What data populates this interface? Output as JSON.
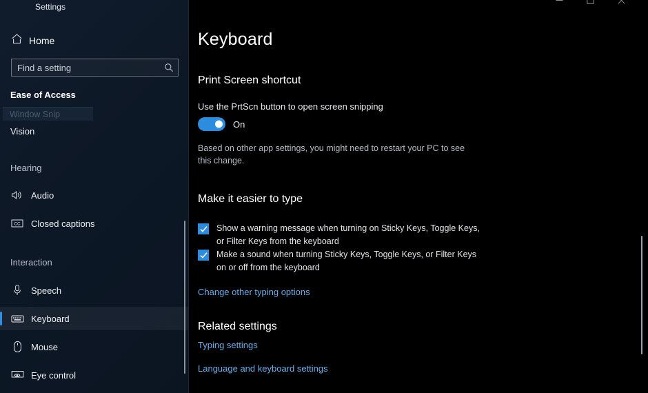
{
  "window": {
    "title": "Settings",
    "controls": {
      "minimize": "minimize-icon",
      "maximize": "maximize-icon",
      "close": "close-icon"
    }
  },
  "sidebar": {
    "home_label": "Home",
    "home_icon": "home-icon",
    "search": {
      "placeholder": "Find a setting",
      "value": "",
      "icon": "search-icon"
    },
    "category_title": "Ease of Access",
    "ghost_overlay": "Window Snip",
    "items": [
      {
        "label": "Vision",
        "icon": "none",
        "selected": false
      },
      {
        "label": "Hearing",
        "icon": "none",
        "selected": false,
        "is_group": true
      },
      {
        "label": "Audio",
        "icon": "speaker-icon",
        "selected": false
      },
      {
        "label": "Closed captions",
        "icon": "closed-captions-icon",
        "selected": false
      },
      {
        "label": "Interaction",
        "icon": "none",
        "selected": false,
        "is_group": true
      },
      {
        "label": "Speech",
        "icon": "microphone-icon",
        "selected": false
      },
      {
        "label": "Keyboard",
        "icon": "keyboard-icon",
        "selected": true
      },
      {
        "label": "Mouse",
        "icon": "mouse-icon",
        "selected": false
      },
      {
        "label": "Eye control",
        "icon": "eye-control-icon",
        "selected": false
      }
    ]
  },
  "main": {
    "page_title": "Keyboard",
    "print_screen": {
      "heading": "Print Screen shortcut",
      "description": "Use the PrtScn button to open screen snipping",
      "toggle_state": "On",
      "toggle_on": true,
      "note": "Based on other app settings, you might need to restart your PC to see this change."
    },
    "easier_to_type": {
      "heading": "Make it easier to type",
      "checkboxes": [
        {
          "label": "Show a warning message when turning on Sticky Keys, Toggle Keys, or Filter Keys from the keyboard",
          "checked": true
        },
        {
          "label": "Make a sound when turning Sticky Keys, Toggle Keys, or Filter Keys on or off from the keyboard",
          "checked": true
        }
      ],
      "link": "Change other typing options"
    },
    "related_settings": {
      "heading": "Related settings",
      "links": [
        "Typing settings",
        "Language and keyboard settings"
      ]
    }
  },
  "colors": {
    "accent": "#2c8ce0",
    "link": "#6aaeea",
    "sidebar_bg": "#0d1826",
    "main_bg": "#000000"
  }
}
